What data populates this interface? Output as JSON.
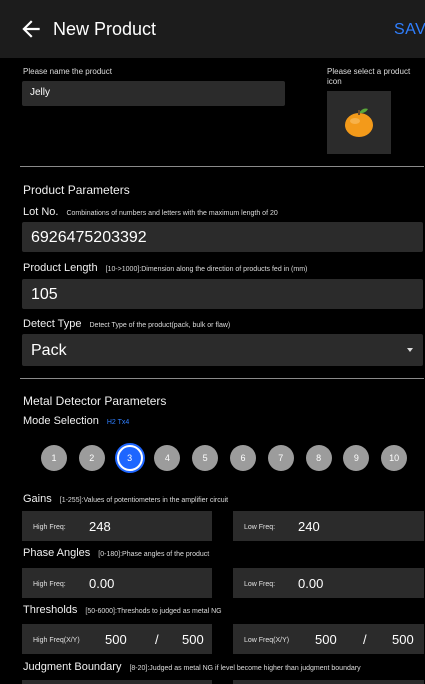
{
  "header": {
    "title": "New Product",
    "save_label": "SAVE"
  },
  "naming": {
    "name_label": "Please name the product",
    "name_value": "Jelly",
    "icon_label": "Please select a product icon",
    "icon_name": "orange-fruit-icon"
  },
  "product_params": {
    "section_title": "Product Parameters",
    "lot_label": "Lot No.",
    "lot_hint": "Combinations of numbers and letters with the maximum length of 20",
    "lot_value": "6926475203392",
    "length_label": "Product Length",
    "length_hint": "[10->1000]:Dimension along the direction of products fed in (mm)",
    "length_value": "105",
    "detect_label": "Detect Type",
    "detect_hint": "Detect Type of the product(pack, bulk or flaw)",
    "detect_value": "Pack"
  },
  "metal_params": {
    "section_title": "Metal Detector Parameters",
    "mode_label": "Mode Selection",
    "mode_value": "H2 Tx4",
    "modes": [
      "1",
      "2",
      "3",
      "4",
      "5",
      "6",
      "7",
      "8",
      "9",
      "10"
    ],
    "selected_mode": "3",
    "gains_label": "Gains",
    "gains_hint": "[1-255]:Values of potentiometers in the amplifier circuit",
    "gains_high_label": "High Freq:",
    "gains_high_value": "248",
    "gains_low_label": "Low Freq:",
    "gains_low_value": "240",
    "phase_label": "Phase Angles",
    "phase_hint": "[0-180]:Phase angles of the product",
    "phase_high_label": "High Freq:",
    "phase_high_value": "0.00",
    "phase_low_label": "Low Freq:",
    "phase_low_value": "0.00",
    "thresh_label": "Thresholds",
    "thresh_hint": "[50-6000]:Threshods to judged as metal NG",
    "thresh_high_label": "High Freq(X/Y)",
    "thresh_high_x": "500",
    "thresh_high_y": "500",
    "thresh_low_label": "Low Freq(X/Y)",
    "thresh_low_x": "500",
    "thresh_low_y": "500",
    "slash": "/",
    "boundary_label": "Judgment Boundary",
    "boundary_hint": "[8-20]:Judged as metal NG if level become higher than judgment boundary"
  },
  "colors": {
    "accent": "#1e66ff",
    "save": "#2f7fff",
    "field": "#2b2b2b",
    "bg": "#000000",
    "bar": "#1c1c1c"
  }
}
